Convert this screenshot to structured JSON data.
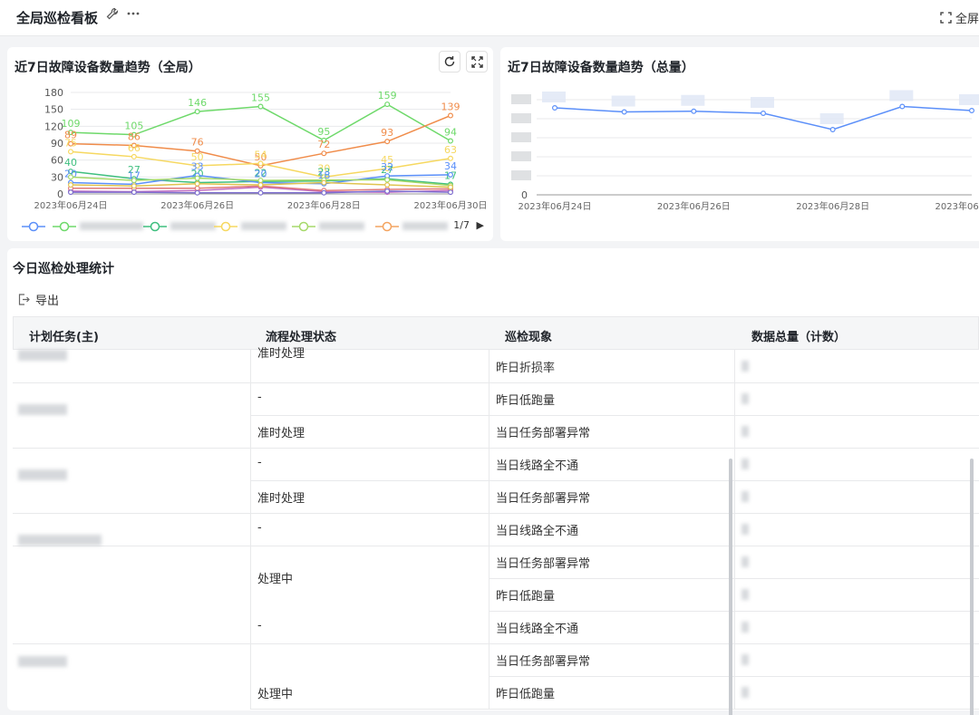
{
  "header": {
    "title": "全局巡检看板",
    "fullscreen_label": "全屏"
  },
  "chart1": {
    "title": "近7日故障设备数量趋势（全局）",
    "legend_page": "1/7",
    "colors": [
      "#5b8ff9",
      "#6ed96a",
      "#3fbf7f",
      "#f6d860",
      "#a6d96a",
      "#f4a460"
    ],
    "chart_data": {
      "type": "line",
      "x": [
        "2023年06月24日",
        "2023年06月25日",
        "2023年06月26日",
        "2023年06月27日",
        "2023年06月28日",
        "2023年06月29日",
        "2023年06月30日"
      ],
      "x_tick_labels": [
        "2023年06月24日",
        "2023年06月26日",
        "2023年06月28日",
        "2023年06月30日"
      ],
      "y_ticks": [
        0,
        30,
        60,
        90,
        120,
        150,
        180
      ],
      "ylim": [
        0,
        180
      ],
      "series": [
        {
          "color": "#6ed96a",
          "values": [
            109,
            105,
            146,
            155,
            95,
            159,
            94
          ],
          "labeled": true
        },
        {
          "color": "#f08c4a",
          "values": [
            89,
            86,
            76,
            50,
            72,
            93,
            139
          ],
          "labeled": true
        },
        {
          "color": "#f6d860",
          "values": [
            75,
            66,
            50,
            54,
            30,
            45,
            63
          ],
          "labeled": true
        },
        {
          "color": "#3fbf7f",
          "values": [
            40,
            27,
            20,
            22,
            23,
            27,
            17
          ],
          "labeled": true
        },
        {
          "color": "#5b8ff9",
          "values": [
            20,
            17,
            33,
            20,
            18,
            32,
            34
          ],
          "labeled": true
        },
        {
          "color": "#a6d96a",
          "values": [
            30,
            24,
            28,
            24,
            25,
            25,
            15
          ],
          "labeled": false
        },
        {
          "color": "#c26ec2",
          "values": [
            5,
            4,
            6,
            12,
            4,
            3,
            6
          ],
          "labeled": false
        },
        {
          "color": "#e07a7a",
          "values": [
            10,
            10,
            10,
            14,
            6,
            8,
            9
          ],
          "labeled": false
        },
        {
          "color": "#7d6ecf",
          "values": [
            3,
            3,
            2,
            2,
            2,
            5,
            3
          ],
          "labeled": false
        },
        {
          "color": "#e0c34f",
          "values": [
            16,
            14,
            18,
            16,
            20,
            16,
            12
          ],
          "labeled": false
        }
      ]
    }
  },
  "chart2": {
    "title": "近7日故障设备数量趋势（总量）",
    "chart_data": {
      "type": "line",
      "x": [
        "2023年06月24日",
        "2023年06月25日",
        "2023年06月26日",
        "2023年06月27日",
        "2023年06月28日",
        "2023年06月29日",
        "2023年06月30日"
      ],
      "x_tick_labels": [
        "2023年06月24日",
        "2023年06月26日",
        "2023年06月28日",
        "2023年06月30日"
      ],
      "y_ticks": [
        0
      ],
      "series": [
        {
          "color": "#5b8ff9",
          "values": [
            640,
            610,
            615,
            600,
            480,
            650,
            620
          ]
        }
      ]
    }
  },
  "stats": {
    "title": "今日巡检处理统计",
    "export_label": "导出",
    "columns": [
      "计划任务(主)",
      "流程处理状态",
      "巡检现象",
      "数据总量（计数）"
    ],
    "rows": [
      {
        "status": "准时处理",
        "phenomenon": "昨日折损率"
      },
      {
        "status": "-",
        "phenomenon": "昨日低跑量"
      },
      {
        "status": "准时处理",
        "phenomenon": "当日任务部署异常"
      },
      {
        "status": "-",
        "phenomenon": "当日线路全不通"
      },
      {
        "status": "准时处理",
        "phenomenon": "当日任务部署异常"
      },
      {
        "status": "-",
        "phenomenon": "当日线路全不通"
      },
      {
        "status": "处理中",
        "phenomenon": "当日任务部署异常"
      },
      {
        "status": "",
        "phenomenon": "昨日低跑量"
      },
      {
        "status": "-",
        "phenomenon": "当日线路全不通"
      },
      {
        "status": "",
        "phenomenon": "当日任务部署异常"
      },
      {
        "status": "处理中",
        "phenomenon": "昨日低跑量"
      }
    ]
  }
}
